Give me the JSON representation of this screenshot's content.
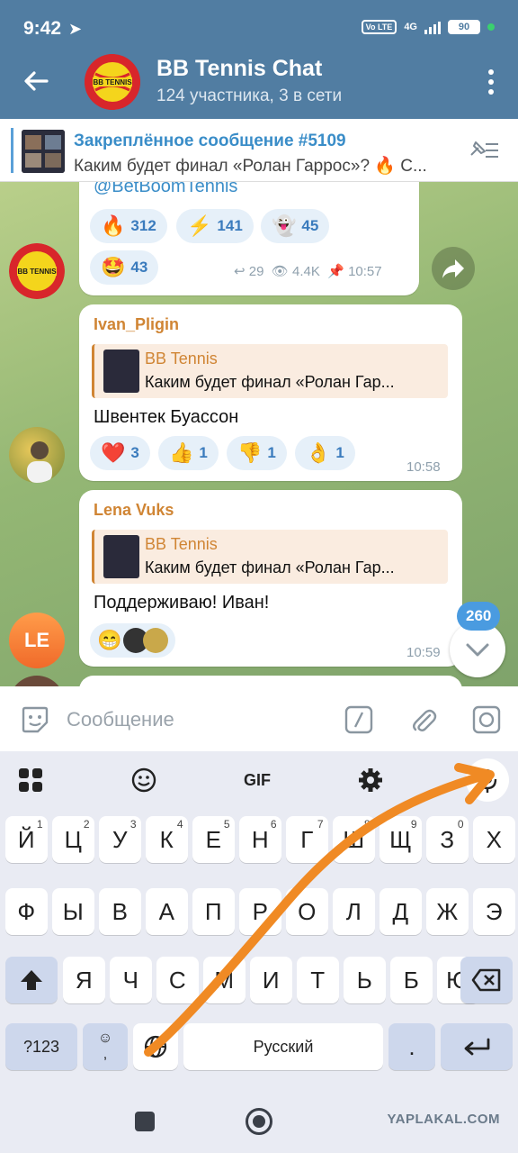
{
  "status": {
    "time": "9:42",
    "network": "4G",
    "volte": "Vo LTE",
    "battery": "90"
  },
  "header": {
    "title": "BB Tennis Chat",
    "subtitle": "124 участника, 3 в сети",
    "avatar_text": "BB TENNIS"
  },
  "pinned": {
    "title": "Закреплённое сообщение #5109",
    "text": "Каким будет финал «Ролан Гаррос»? 🔥 С..."
  },
  "messages": [
    {
      "partial_text": "@BetBoomTennis",
      "reactions": [
        {
          "emoji": "🔥",
          "count": "312"
        },
        {
          "emoji": "⚡",
          "count": "141"
        },
        {
          "emoji": "👻",
          "count": "45"
        },
        {
          "emoji": "🤩",
          "count": "43"
        }
      ],
      "replies": "29",
      "views": "4.4K",
      "time": "10:57"
    },
    {
      "sender": "Ivan_Pligin",
      "quote_title": "BB Tennis",
      "quote_text": "Каким будет финал «Ролан Гар...",
      "text": "Швентек Буассон",
      "reactions": [
        {
          "emoji": "❤️",
          "count": "3"
        },
        {
          "emoji": "👍",
          "count": "1"
        },
        {
          "emoji": "👎",
          "count": "1"
        },
        {
          "emoji": "👌",
          "count": "1"
        }
      ],
      "time": "10:58"
    },
    {
      "sender": "Lena Vuks",
      "avatar_initials": "LE",
      "quote_title": "BB Tennis",
      "quote_text": "Каким будет финал «Ролан Гар...",
      "text": "Поддерживаю! Иван!",
      "reactions": [
        {
          "emoji": "😁"
        }
      ],
      "time": "10:59"
    }
  ],
  "unread_count": "260",
  "composer": {
    "placeholder": "Сообщение"
  },
  "keyboard": {
    "toolbar": {
      "gif": "GIF"
    },
    "row1": [
      "Й",
      "Ц",
      "У",
      "К",
      "Е",
      "Н",
      "Г",
      "Ш",
      "Щ",
      "З",
      "Х"
    ],
    "row1_hints": [
      "1",
      "2",
      "3",
      "4",
      "5",
      "6",
      "7",
      "8",
      "9",
      "0",
      ""
    ],
    "row2": [
      "Ф",
      "Ы",
      "В",
      "А",
      "П",
      "Р",
      "О",
      "Л",
      "Д",
      "Ж",
      "Э"
    ],
    "row3": [
      "Я",
      "Ч",
      "С",
      "М",
      "И",
      "Т",
      "Ь",
      "Б",
      "Ю"
    ],
    "sym_key": "?123",
    "space_label": "Русский",
    "period": ".",
    "comma": ","
  },
  "watermark": "YAPLAKAL.COM",
  "colors": {
    "header": "#517da2",
    "accent": "#3a8dc8",
    "sender": "#d08534",
    "arrow": "#f08a24"
  }
}
